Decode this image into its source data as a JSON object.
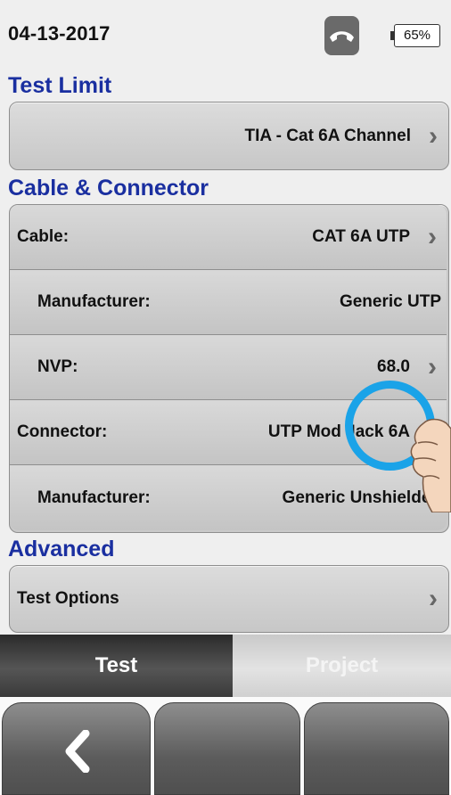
{
  "status": {
    "date": "04-13-2017",
    "battery": "65%",
    "phone_icon": "phone-hangup-icon"
  },
  "test_limit": {
    "heading": "Test Limit",
    "value": "TIA - Cat 6A Channel"
  },
  "cable_connector": {
    "heading": "Cable & Connector",
    "rows": [
      {
        "label": "Cable:",
        "value": "CAT 6A UTP",
        "chevron": true
      },
      {
        "label": "Manufacturer:",
        "value": "Generic UTP",
        "chevron": false
      },
      {
        "label": "NVP:",
        "value": "68.0",
        "chevron": true
      },
      {
        "label": "Connector:",
        "value": "UTP Mod Jack 6A",
        "chevron": true
      },
      {
        "label": "Manufacturer:",
        "value": "Generic Unshielded",
        "chevron": false
      }
    ]
  },
  "advanced": {
    "heading": "Advanced",
    "test_options_label": "Test Options"
  },
  "tabs": {
    "test": "Test",
    "project": "Project"
  },
  "softkeys": {
    "back_icon": "chevron-left-icon"
  },
  "colors": {
    "section_heading": "#1a2fa0",
    "touch_indicator": "#1aa3e8"
  }
}
